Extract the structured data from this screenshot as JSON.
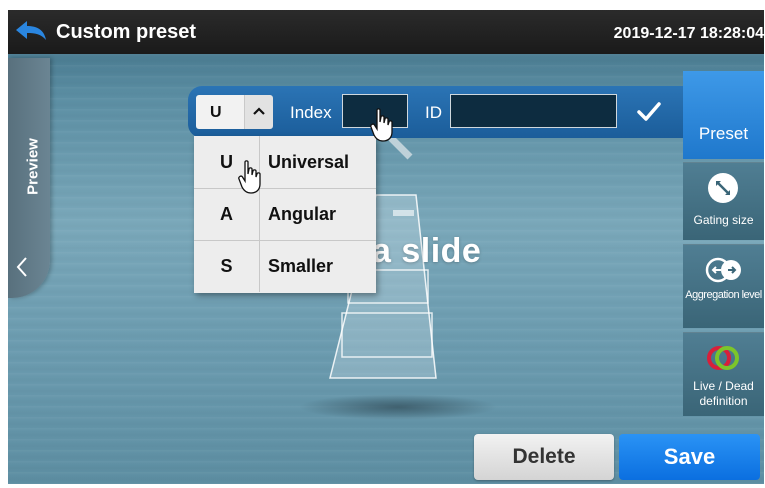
{
  "header": {
    "title": "Custom preset",
    "datetime": "2019-12-17 18:28:04",
    "back_icon": "back-arrow-icon"
  },
  "preview": {
    "label": "Preview",
    "chevron_icon": "chevron-left-icon"
  },
  "canvas": {
    "slide_text": "a slide"
  },
  "filter_bar": {
    "selected_code": "U",
    "caret_icon": "chevron-up-icon",
    "index_label": "Index",
    "index_value": "",
    "id_label": "ID",
    "id_value": "",
    "confirm_icon": "checkmark-icon"
  },
  "dropdown": {
    "options": [
      {
        "code": "U",
        "label": "Universal"
      },
      {
        "code": "A",
        "label": "Angular"
      },
      {
        "code": "S",
        "label": "Smaller"
      }
    ]
  },
  "sidebar": {
    "preset": "Preset",
    "gating_size": "Gating size",
    "aggregation_level": "Aggregation level",
    "live_dead_definition": "Live / Dead definition"
  },
  "footer": {
    "delete": "Delete",
    "save": "Save"
  },
  "colors": {
    "accent_blue": "#1f78cc",
    "save_blue": "#0b6fe0",
    "ring_red": "#d81f3a",
    "ring_green": "#7cc52a"
  }
}
